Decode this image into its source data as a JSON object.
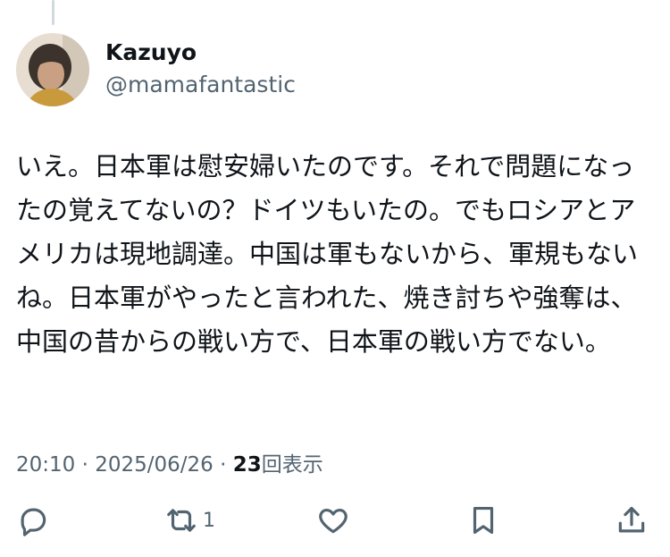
{
  "author": {
    "display_name": "Kazuyo",
    "handle": "@mamafantastic"
  },
  "post": {
    "text": "いえ。日本軍は慰安婦いたのです。それで問題になったの覚えてないの？ドイツもいたの。でもロシアとアメリカは現地調達。中国は軍もないから、軍規もないね。日本軍がやったと言われた、焼き討ちや強奪は、中国の昔からの戦い方で、日本軍の戦い方でない。",
    "time": "20:10",
    "date": "2025/06/26",
    "separator": "·",
    "views_count": "23",
    "views_label": "回表示"
  },
  "actions": {
    "reply_icon": "reply-icon",
    "repost_icon": "repost-icon",
    "repost_count": "1",
    "like_icon": "heart-icon",
    "bookmark_icon": "bookmark-icon",
    "share_icon": "share-icon"
  },
  "colors": {
    "text_primary": "#0f1419",
    "text_secondary": "#536471",
    "thread_line": "#cfd9de"
  }
}
